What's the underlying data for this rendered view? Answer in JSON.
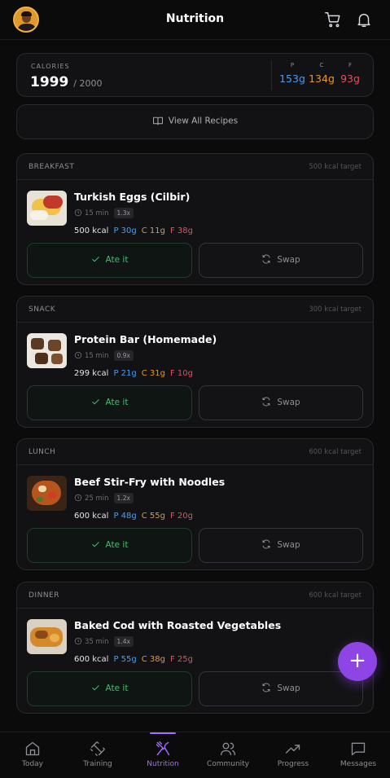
{
  "header": {
    "title": "Nutrition"
  },
  "calories": {
    "label": "CALORIES",
    "consumed": "1999",
    "target": "/ 2000",
    "macros": [
      {
        "letter": "P",
        "value": "153g",
        "color": "#4a9df0"
      },
      {
        "letter": "C",
        "value": "134g",
        "color": "#e6962f"
      },
      {
        "letter": "F",
        "value": "93g",
        "color": "#e0525b"
      }
    ]
  },
  "recipes_button": {
    "label": "View All Recipes"
  },
  "meals": [
    {
      "type": "BREAKFAST",
      "target": "500 kcal target",
      "name": "Turkish Eggs (Cilbir)",
      "time": "15 min",
      "portion": "1.3x",
      "kcal": "500 kcal",
      "p": "P 30g",
      "c": "C 11g",
      "f": "F 38g",
      "ate_label": "Ate it",
      "swap_label": "Swap"
    },
    {
      "type": "SNACK",
      "target": "300 kcal target",
      "name": "Protein Bar (Homemade)",
      "time": "15 min",
      "portion": "0.9x",
      "kcal": "299 kcal",
      "p": "P 21g",
      "c": "C 31g",
      "f": "F 10g",
      "ate_label": "Ate it",
      "swap_label": "Swap"
    },
    {
      "type": "LUNCH",
      "target": "600 kcal target",
      "name": "Beef Stir-Fry with Noodles",
      "time": "25 min",
      "portion": "1.2x",
      "kcal": "600 kcal",
      "p": "P 48g",
      "c": "C 55g",
      "f": "F 20g",
      "ate_label": "Ate it",
      "swap_label": "Swap"
    },
    {
      "type": "DINNER",
      "target": "600 kcal target",
      "name": "Baked Cod with Roasted Vegetables",
      "time": "35 min",
      "portion": "1.4x",
      "kcal": "600 kcal",
      "p": "P 55g",
      "c": "C 38g",
      "f": "F 25g",
      "ate_label": "Ate it",
      "swap_label": "Swap"
    }
  ],
  "fab": {
    "label": "+"
  },
  "nav": [
    {
      "label": "Today",
      "icon": "home-icon"
    },
    {
      "label": "Training",
      "icon": "dumbbell-icon"
    },
    {
      "label": "Nutrition",
      "icon": "utensils-icon",
      "active": true
    },
    {
      "label": "Community",
      "icon": "users-icon"
    },
    {
      "label": "Progress",
      "icon": "trending-up-icon"
    },
    {
      "label": "Messages",
      "icon": "message-icon"
    }
  ],
  "colors": {
    "accent": "#a76bff",
    "fab": "#8e45e6",
    "ate": "#3fbf73",
    "protein": "#4a9df0",
    "carbs": "#e6962f",
    "fat": "#e0525b"
  }
}
